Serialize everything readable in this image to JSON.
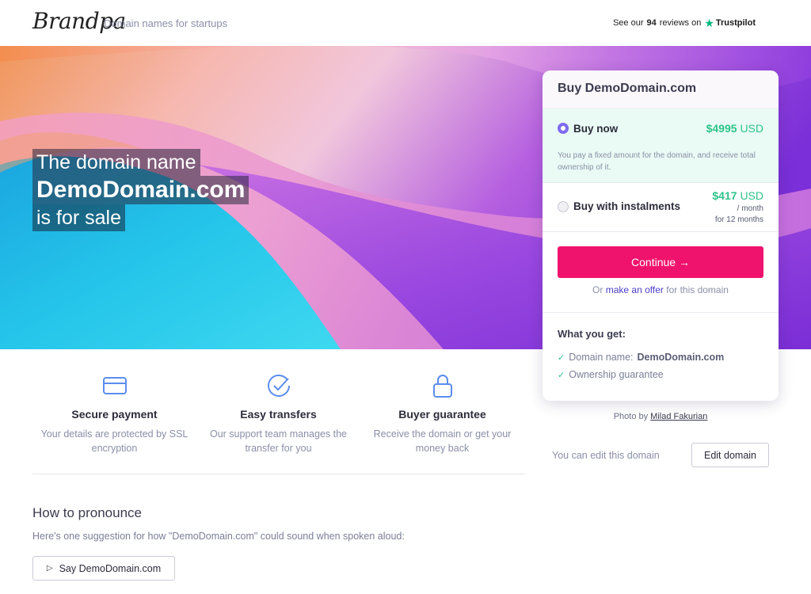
{
  "header": {
    "logo": "Brandpa",
    "tagline": "Domain names for startups",
    "reviews_prefix": "See our",
    "reviews_count": "94",
    "reviews_suffix": "reviews on",
    "trustpilot": "Trustpilot"
  },
  "hero": {
    "line1": "The domain name",
    "domain": "DemoDomain.com",
    "line3": "is for sale"
  },
  "features": [
    {
      "icon": "credit-card-icon",
      "title": "Secure payment",
      "desc": "Your details are protected by SSL encryption"
    },
    {
      "icon": "check-circle-icon",
      "title": "Easy transfers",
      "desc": "Our support team manages the transfer for you"
    },
    {
      "icon": "lock-icon",
      "title": "Buyer guarantee",
      "desc": "Receive the domain or get your money back"
    }
  ],
  "pronounce": {
    "title": "How to pronounce",
    "desc": "Here's one suggestion for how \"DemoDomain.com\" could sound when spoken aloud:",
    "button": "Say DemoDomain.com"
  },
  "card": {
    "title": "Buy DemoDomain.com",
    "buy_now": {
      "label": "Buy now",
      "price": "$4995",
      "currency": "USD",
      "note": "You pay a fixed amount for the domain, and receive total ownership of it.",
      "selected": true
    },
    "instalments": {
      "label": "Buy with instalments",
      "price": "$417",
      "currency": "USD",
      "per": "/ month",
      "term": "for 12 months",
      "selected": false
    },
    "continue": "Continue →",
    "offer_prefix": "Or",
    "offer_link": "make an offer",
    "offer_suffix": "for this domain",
    "what_you_get": "What you get:",
    "items": [
      {
        "label": "Domain name:",
        "value": "DemoDomain.com"
      },
      {
        "label": "Ownership guarantee",
        "value": ""
      }
    ]
  },
  "photo": {
    "prefix": "Photo by",
    "author": "Milad Fakurian"
  },
  "edit": {
    "note": "You can edit this domain",
    "button": "Edit domain"
  },
  "colors": {
    "accent": "#f0136d",
    "price": "#2dc48a",
    "radio": "#7f6bf0",
    "link": "#4b3fc8",
    "trustpilot_star": "#00b67a"
  }
}
